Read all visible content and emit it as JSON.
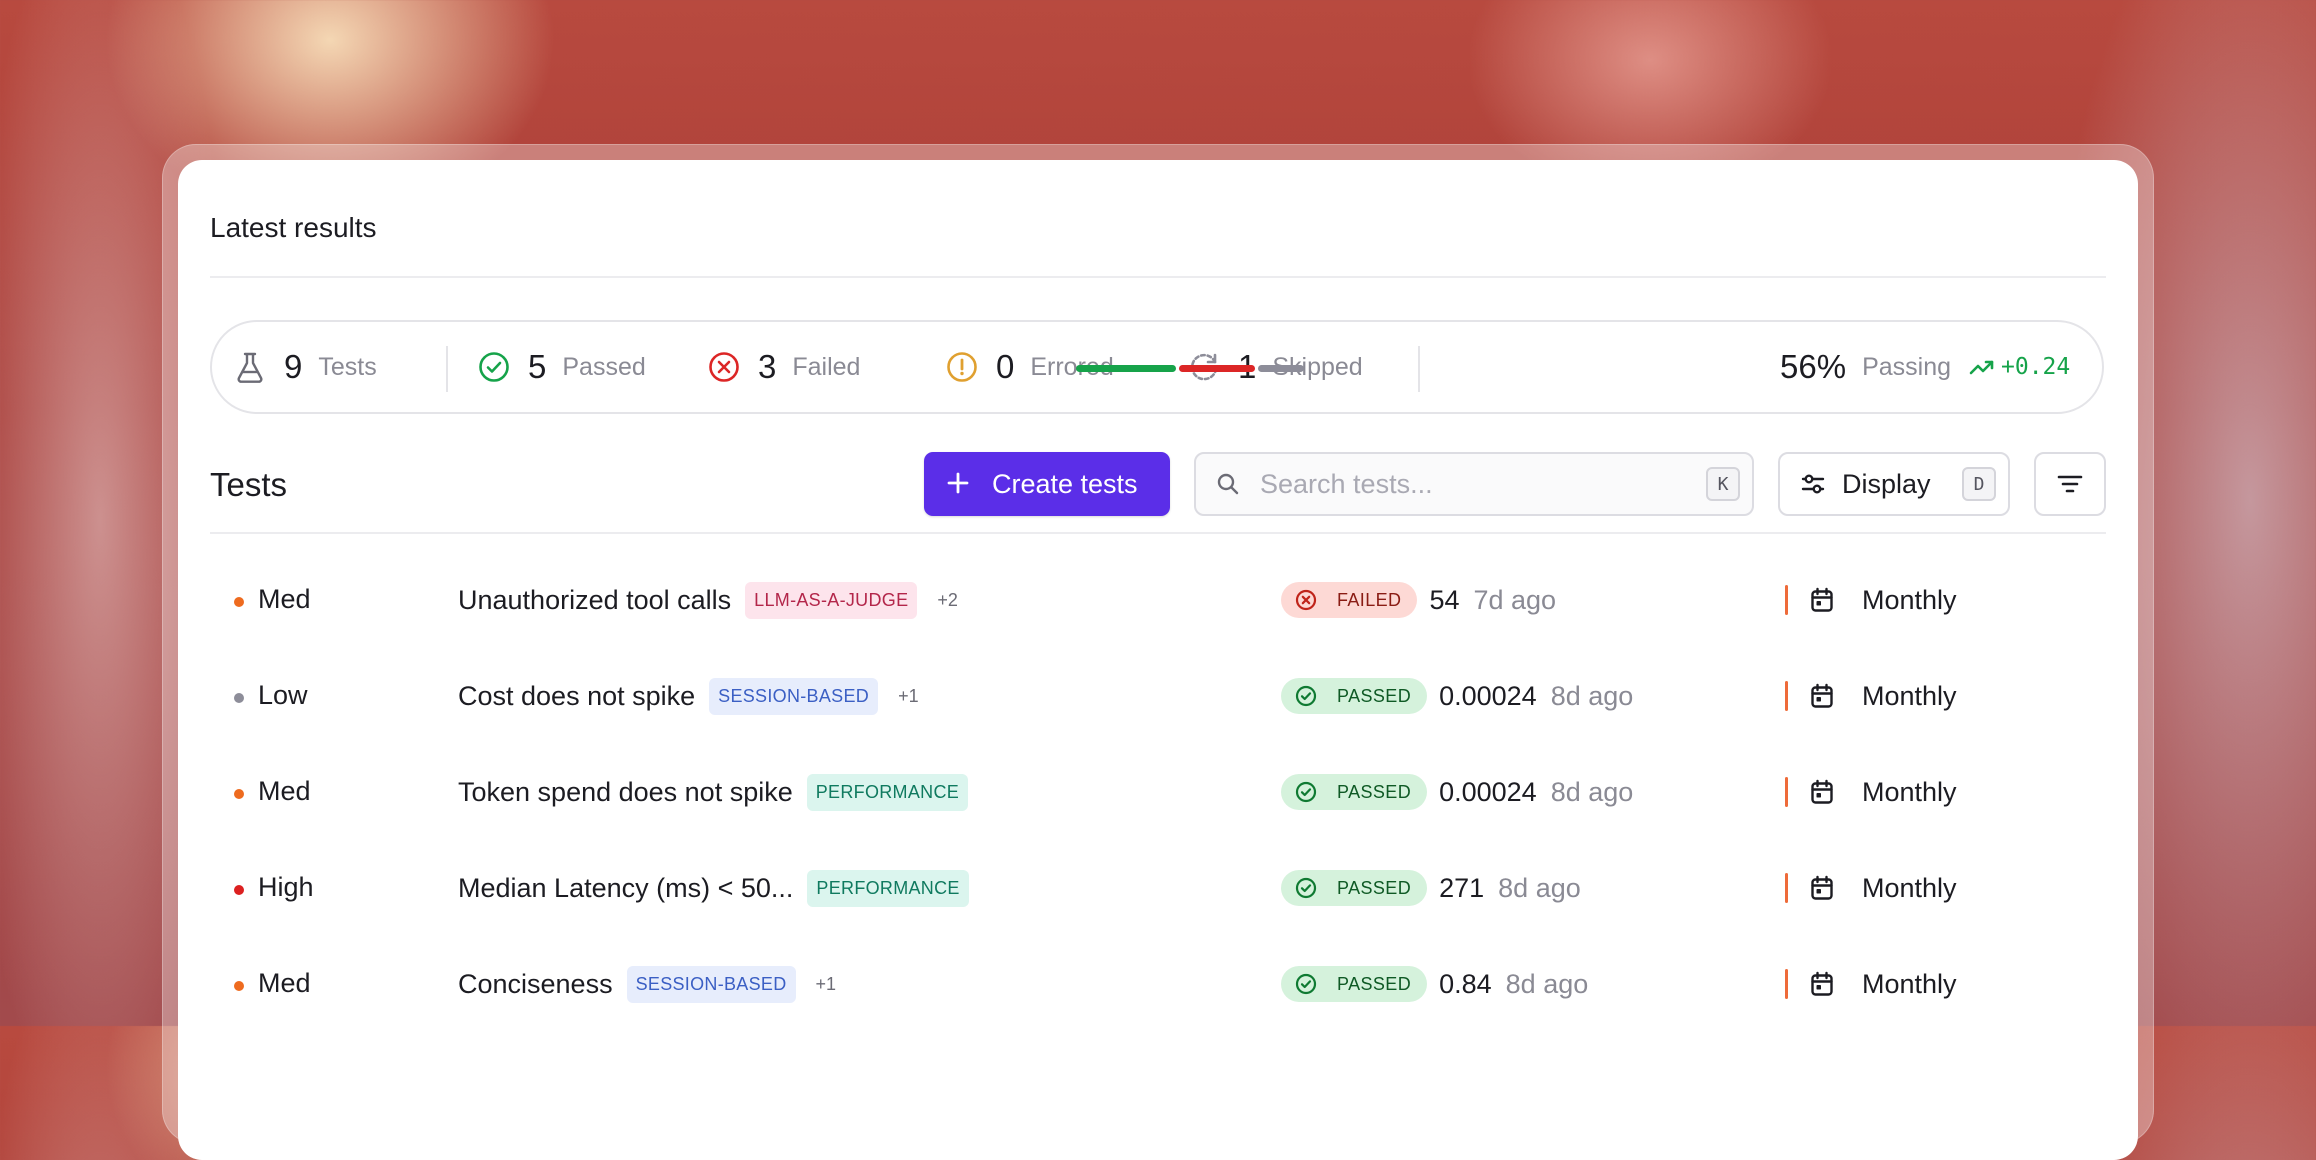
{
  "section_title": "Latest results",
  "stats": {
    "tests": {
      "value": "9",
      "label": "Tests",
      "icon": "flask-icon"
    },
    "passed": {
      "value": "5",
      "label": "Passed",
      "icon": "check-circle-icon"
    },
    "failed": {
      "value": "3",
      "label": "Failed",
      "icon": "x-circle-icon"
    },
    "errored": {
      "value": "0",
      "label": "Errored",
      "icon": "alert-circle-icon"
    },
    "skipped": {
      "value": "1",
      "label": "Skipped",
      "icon": "refresh-dashed-icon"
    },
    "progress": {
      "passed_fraction": 0.45,
      "failed_fraction": 0.35,
      "other_fraction": 0.2
    },
    "passing_percent": "56%",
    "passing_label": "Passing",
    "trend": "+0.24"
  },
  "tests_header": {
    "title": "Tests",
    "create_label": "Create tests",
    "search_placeholder": "Search tests...",
    "search_shortcut": "K",
    "display_label": "Display",
    "display_shortcut": "D"
  },
  "rows": [
    {
      "priority": "Med",
      "priority_color": "#ee6b1f",
      "name": "Unauthorized tool calls",
      "tag": "LLM-AS-A-JUDGE",
      "tag_style": "pink",
      "more": "+2",
      "status": "FAILED",
      "score": "54",
      "ago": "7d ago",
      "schedule": "Monthly"
    },
    {
      "priority": "Low",
      "priority_color": "#8d8d99",
      "name": "Cost does not spike",
      "tag": "SESSION-BASED",
      "tag_style": "blue",
      "more": "+1",
      "status": "PASSED",
      "score": "0.00024",
      "ago": "8d ago",
      "schedule": "Monthly"
    },
    {
      "priority": "Med",
      "priority_color": "#ee6b1f",
      "name": "Token spend does not spike",
      "tag": "PERFORMANCE",
      "tag_style": "teal",
      "more": "",
      "status": "PASSED",
      "score": "0.00024",
      "ago": "8d ago",
      "schedule": "Monthly"
    },
    {
      "priority": "High",
      "priority_color": "#dc2020",
      "name": "Median Latency (ms) < 50...",
      "tag": "PERFORMANCE",
      "tag_style": "teal",
      "more": "",
      "status": "PASSED",
      "score": "271",
      "ago": "8d ago",
      "schedule": "Monthly"
    },
    {
      "priority": "Med",
      "priority_color": "#ee6b1f",
      "name": "Conciseness",
      "tag": "SESSION-BASED",
      "tag_style": "blue",
      "more": "+1",
      "status": "PASSED",
      "score": "0.84",
      "ago": "8d ago",
      "schedule": "Monthly"
    }
  ],
  "colors": {
    "accent": "#5b2ee8",
    "passed": "#16a34a",
    "failed": "#dc2626",
    "errored": "#e0a030",
    "neutral": "#8d8d99"
  }
}
